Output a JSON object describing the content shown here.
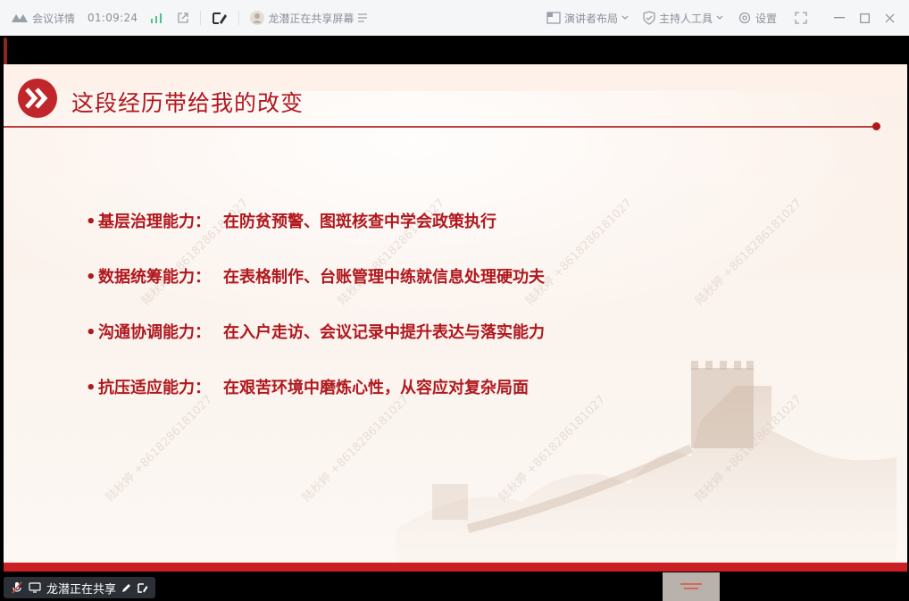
{
  "toolbar": {
    "meeting_details_label": "会议详情",
    "timer": "01:09:24",
    "sharer_status": "龙潜正在共享屏幕",
    "presenter_layout_label": "演讲者布局",
    "host_tools_label": "主持人工具",
    "settings_label": "设置"
  },
  "slide": {
    "title": "这段经历带给我的改变",
    "bullets": [
      {
        "label": "基层治理能力：",
        "text": "在防贫预警、图斑核查中学会政策执行"
      },
      {
        "label": "数据统筹能力：",
        "text": "在表格制作、台账管理中练就信息处理硬功夫"
      },
      {
        "label": "沟通协调能力：",
        "text": "在入户走访、会议记录中提升表达与落实能力"
      },
      {
        "label": "抗压适应能力：",
        "text": "在艰苦环境中磨炼心性，从容应对复杂局面"
      }
    ],
    "watermark_text": "陆秋婷 +8618286181027"
  },
  "status_bar": {
    "share_label": "龙潜正在共享"
  },
  "colors": {
    "accent_red": "#b0181e",
    "toolbar_bg": "#f5f6f7",
    "toolbar_text": "#8a8f99"
  }
}
